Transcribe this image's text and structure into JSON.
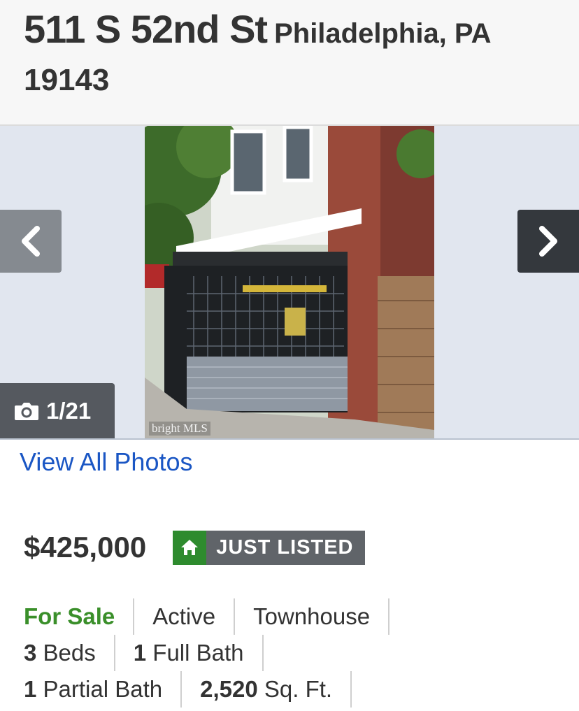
{
  "header": {
    "street": "511 S 52nd St",
    "city_state": "Philadelphia, PA",
    "zip": "19143"
  },
  "gallery": {
    "counter": "1/21",
    "watermark": "bright MLS",
    "prev_icon": "chevron-left-icon",
    "next_icon": "chevron-right-icon",
    "camera_icon": "camera-icon"
  },
  "view_all_label": "View All Photos",
  "listing": {
    "price": "$425,000",
    "badge": "JUST LISTED",
    "badge_icon": "home-icon",
    "status_type": "For Sale",
    "status": "Active",
    "property_type": "Townhouse",
    "beds_num": "3",
    "beds_label": "Beds",
    "full_bath_num": "1",
    "full_bath_label": "Full Bath",
    "partial_bath_num": "1",
    "partial_bath_label": "Partial Bath",
    "sqft_num": "2,520",
    "sqft_label": "Sq. Ft."
  },
  "colors": {
    "link": "#1a56c4",
    "for_sale": "#3a8f2a",
    "badge_green": "#2e8b2e",
    "badge_gray": "#606469"
  }
}
